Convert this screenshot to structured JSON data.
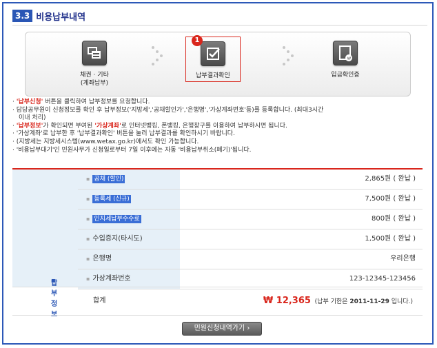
{
  "section": {
    "number": "3.3",
    "title": "비용납부내역"
  },
  "steps": [
    {
      "label_line1": "채권 · 기타",
      "label_line2": "(계좌납부)"
    },
    {
      "label_line1": "납부결과확인",
      "label_line2": ""
    },
    {
      "label_line1": "입금확인증",
      "label_line2": ""
    }
  ],
  "step_badge": "1",
  "notes": [
    {
      "hl": "'납부신청'",
      "text": " 버튼을 클릭하여 납부정보를 요청합니다."
    },
    {
      "hl": "",
      "text": "담당공무원이 신청정보를 확인 후 납부정보('지방세','공채할인가','은행명','가상계좌번호'등)를 등록합니다. (최대3시간"
    },
    {
      "hl": "",
      "text": "이내 처리)"
    },
    {
      "hl": "'납부정보'",
      "text": "가 확인되면 부여된 ",
      "hl2": "'가상계좌'",
      "text2": "로 인터넷뱅킹, 폰뱅킹, 은행창구를 이용하여 납부하시면 됩니다."
    },
    {
      "hl": "",
      "text": "'가상계좌'로 납부한 후 '납부결과확인' 버튼을 눌러 납부결과를 확인하시기 바랍니다."
    },
    {
      "hl": "",
      "text": "(지방세는 지방세시스템(www.wetax.go.kr)에서도 확인 가능합니다."
    },
    {
      "hl": "",
      "text": "'비용납부대기'인 민원사무가 신청일로부터 7일 이후에는 자동 '비용납부취소(폐기)'됩니다."
    }
  ],
  "payment": {
    "section_label": "납부정보",
    "rows": [
      {
        "key": "공채 (할인)",
        "pill": true,
        "value": "2,865원 ( 완납 )"
      },
      {
        "key": "등록세 (신규)",
        "pill": true,
        "value": "7,500원 ( 완납 )"
      },
      {
        "key": "인지세납부수수료",
        "pill": true,
        "value": "800원 ( 완납 )"
      },
      {
        "key": "수입증지(타시도)",
        "pill": false,
        "value": "1,500원 ( 완납 )"
      },
      {
        "key": "은행명",
        "pill": false,
        "value": "우리은행"
      },
      {
        "key": "가상계좌번호",
        "pill": false,
        "value": "123-12345-123456"
      }
    ],
    "total_label": "합계",
    "total_amount": "₩ 12,365",
    "total_note_pre": "(납부 기한은",
    "total_deadline": "2011-11-29",
    "total_note_post": "입니다.)"
  },
  "button_label": "민원신청내역가기 ›",
  "colors": {
    "accent_red": "#d9261c",
    "brand_blue": "#2a56b5",
    "row_bg": "#e6f0f8"
  }
}
